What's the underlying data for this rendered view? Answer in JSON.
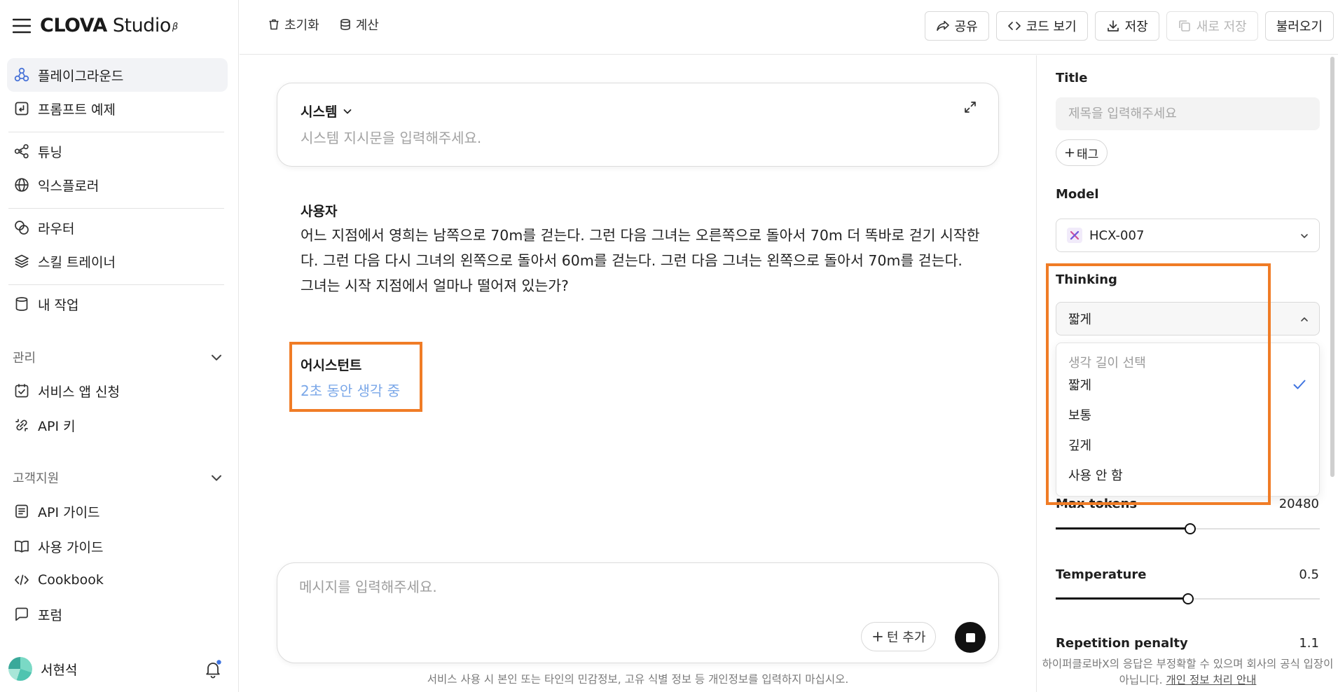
{
  "brand": {
    "name": "CLOVA",
    "product": "Studio",
    "badge": "β"
  },
  "sidebar": {
    "items": [
      {
        "label": "플레이그라운드",
        "icon": "playground-icon",
        "active": true
      },
      {
        "label": "프롬프트 예제",
        "icon": "prompt-example-icon"
      },
      {
        "label": "튜닝",
        "icon": "tuning-icon"
      },
      {
        "label": "익스플로러",
        "icon": "explorer-icon"
      },
      {
        "label": "라우터",
        "icon": "router-icon"
      },
      {
        "label": "스킬 트레이너",
        "icon": "skill-trainer-icon"
      },
      {
        "label": "내 작업",
        "icon": "my-work-icon"
      }
    ],
    "manage": {
      "title": "관리",
      "items": [
        {
          "label": "서비스 앱 신청",
          "icon": "service-app-icon"
        },
        {
          "label": "API 키",
          "icon": "api-key-icon"
        }
      ]
    },
    "support": {
      "title": "고객지원",
      "items": [
        {
          "label": "API 가이드",
          "icon": "api-guide-icon"
        },
        {
          "label": "사용 가이드",
          "icon": "user-guide-icon"
        },
        {
          "label": "Cookbook",
          "icon": "cookbook-icon"
        },
        {
          "label": "포럼",
          "icon": "forum-icon"
        }
      ]
    },
    "user": {
      "name": "서현석"
    }
  },
  "toolbar": {
    "reset_label": "초기화",
    "calc_label": "계산",
    "share_label": "공유",
    "code_label": "코드 보기",
    "save_label": "저장",
    "save_new_label": "새로 저장",
    "load_label": "불러오기"
  },
  "system": {
    "title": "시스템",
    "placeholder": "시스템 지시문을 입력해주세요."
  },
  "conversation": {
    "user_role": "사용자",
    "user_text": "어느 지점에서 영희는 남쪽으로 70m를 걷는다. 그런 다음 그녀는 오른쪽으로 돌아서 70m 더 똑바로 걷기 시작한다. 그런 다음 다시 그녀의 왼쪽으로 돌아서 60m를 걷는다. 그런 다음 그녀는 왼쪽으로 돌아서 70m를 걷는다. 그녀는 시작 지점에서 얼마나 떨어져 있는가?",
    "assistant_role": "어시스턴트",
    "assistant_status": "2초 동안 생각 중"
  },
  "composer": {
    "placeholder": "메시지를 입력해주세요.",
    "add_turn_label": "턴 추가",
    "disclaimer": "서비스 사용 시 본인 또는 타인의 민감정보, 고유 식별 정보 등 개인정보를 입력하지 마십시오."
  },
  "settings": {
    "title_label": "Title",
    "title_placeholder": "제목을 입력해주세요",
    "tag_label": "태그",
    "model_label": "Model",
    "model_value": "HCX-007",
    "thinking_label": "Thinking",
    "thinking_value": "짧게",
    "thinking_menu": {
      "header": "생각 길이 선택",
      "options": [
        "짧게",
        "보통",
        "깊게",
        "사용 안 함"
      ],
      "selected": "짧게"
    },
    "max_tokens": {
      "label": "Max tokens",
      "value": "20480",
      "fraction": 0.51
    },
    "temperature": {
      "label": "Temperature",
      "value": "0.5",
      "fraction": 0.5
    },
    "repetition_penalty": {
      "label": "Repetition penalty",
      "value": "1.1"
    },
    "footer_text": "하이퍼클로바X의 응답은 부정확할 수 있으며 회사의 공식 입장이 아닙니다.",
    "footer_link": "개인 정보 처리 안내"
  },
  "colors": {
    "highlight": "#f07c26",
    "thinking_status": "#7aa7e8",
    "active_nav_bg": "#f2f3f6",
    "check": "#3f74e0"
  }
}
